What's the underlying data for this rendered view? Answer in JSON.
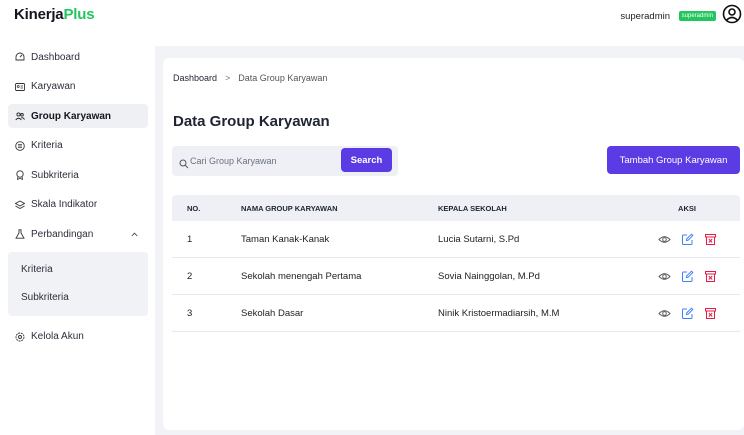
{
  "brand": {
    "part1": "Kinerja",
    "part2": "Plus"
  },
  "sidebar": {
    "items": [
      {
        "label": "Dashboard",
        "icon": "dashboard-icon"
      },
      {
        "label": "Karyawan",
        "icon": "id-card-icon"
      },
      {
        "label": "Group Karyawan",
        "icon": "users-icon",
        "active": true
      },
      {
        "label": "Kriteria",
        "icon": "list-icon"
      },
      {
        "label": "Subkriteria",
        "icon": "badge-icon"
      },
      {
        "label": "Skala Indikator",
        "icon": "layers-icon"
      },
      {
        "label": "Perbandingan",
        "icon": "flask-icon",
        "expanded": true
      }
    ],
    "submenu": [
      {
        "label": "Kriteria"
      },
      {
        "label": "Subkriteria"
      }
    ],
    "footer_item": {
      "label": "Kelola Akun",
      "icon": "gear-icon"
    }
  },
  "topbar": {
    "username": "superadmin",
    "role": "superadmin"
  },
  "breadcrumb": {
    "home": "Dashboard",
    "separator": ">",
    "current": "Data Group Karyawan"
  },
  "page": {
    "title": "Data Group Karyawan"
  },
  "search": {
    "placeholder": "Cari Group Karyawan",
    "button": "Search"
  },
  "add_button": "Tambah Group Karyawan",
  "table": {
    "headers": {
      "no": "NO.",
      "name": "NAMA GROUP KARYAWAN",
      "kepala": "KEPALA SEKOLAH",
      "aksi": "AKSI"
    },
    "rows": [
      {
        "no": "1",
        "name": "Taman Kanak-Kanak",
        "kepala": "Lucia Sutarni, S.Pd"
      },
      {
        "no": "2",
        "name": "Sekolah menengah Pertama",
        "kepala": "Sovia Nainggolan, M.Pd"
      },
      {
        "no": "3",
        "name": "Sekolah Dasar",
        "kepala": "Ninik Kristoermadiarsih, M.M"
      }
    ]
  },
  "colors": {
    "accent": "#5b3ce4",
    "brand_green": "#22c55e",
    "delete_red": "#e11d48",
    "edit_blue": "#3b82f6"
  }
}
